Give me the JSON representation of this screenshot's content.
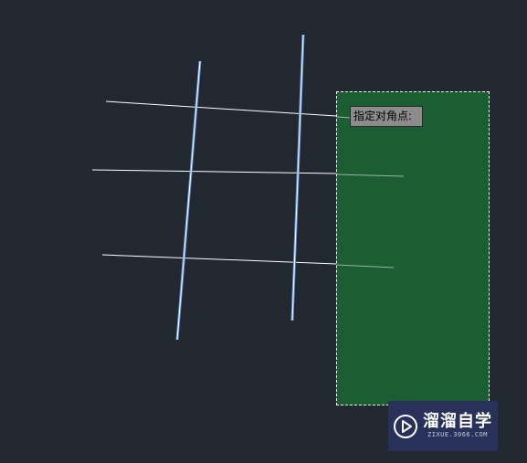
{
  "prompt": {
    "text": "指定对角点:"
  },
  "watermark": {
    "name": "溜溜自学",
    "url": "ZIXUE.3066.COM"
  },
  "colors": {
    "background": "#212830",
    "selection_fill": "#1b5e32",
    "selection_border": "#ffffff",
    "highlighted_line": "#5b8fd6",
    "normal_line": "#ffffff",
    "tooltip_bg": "#8c8c8c",
    "watermark_bg": "#27315a"
  },
  "icons": {
    "watermark_logo": "play-icon"
  }
}
